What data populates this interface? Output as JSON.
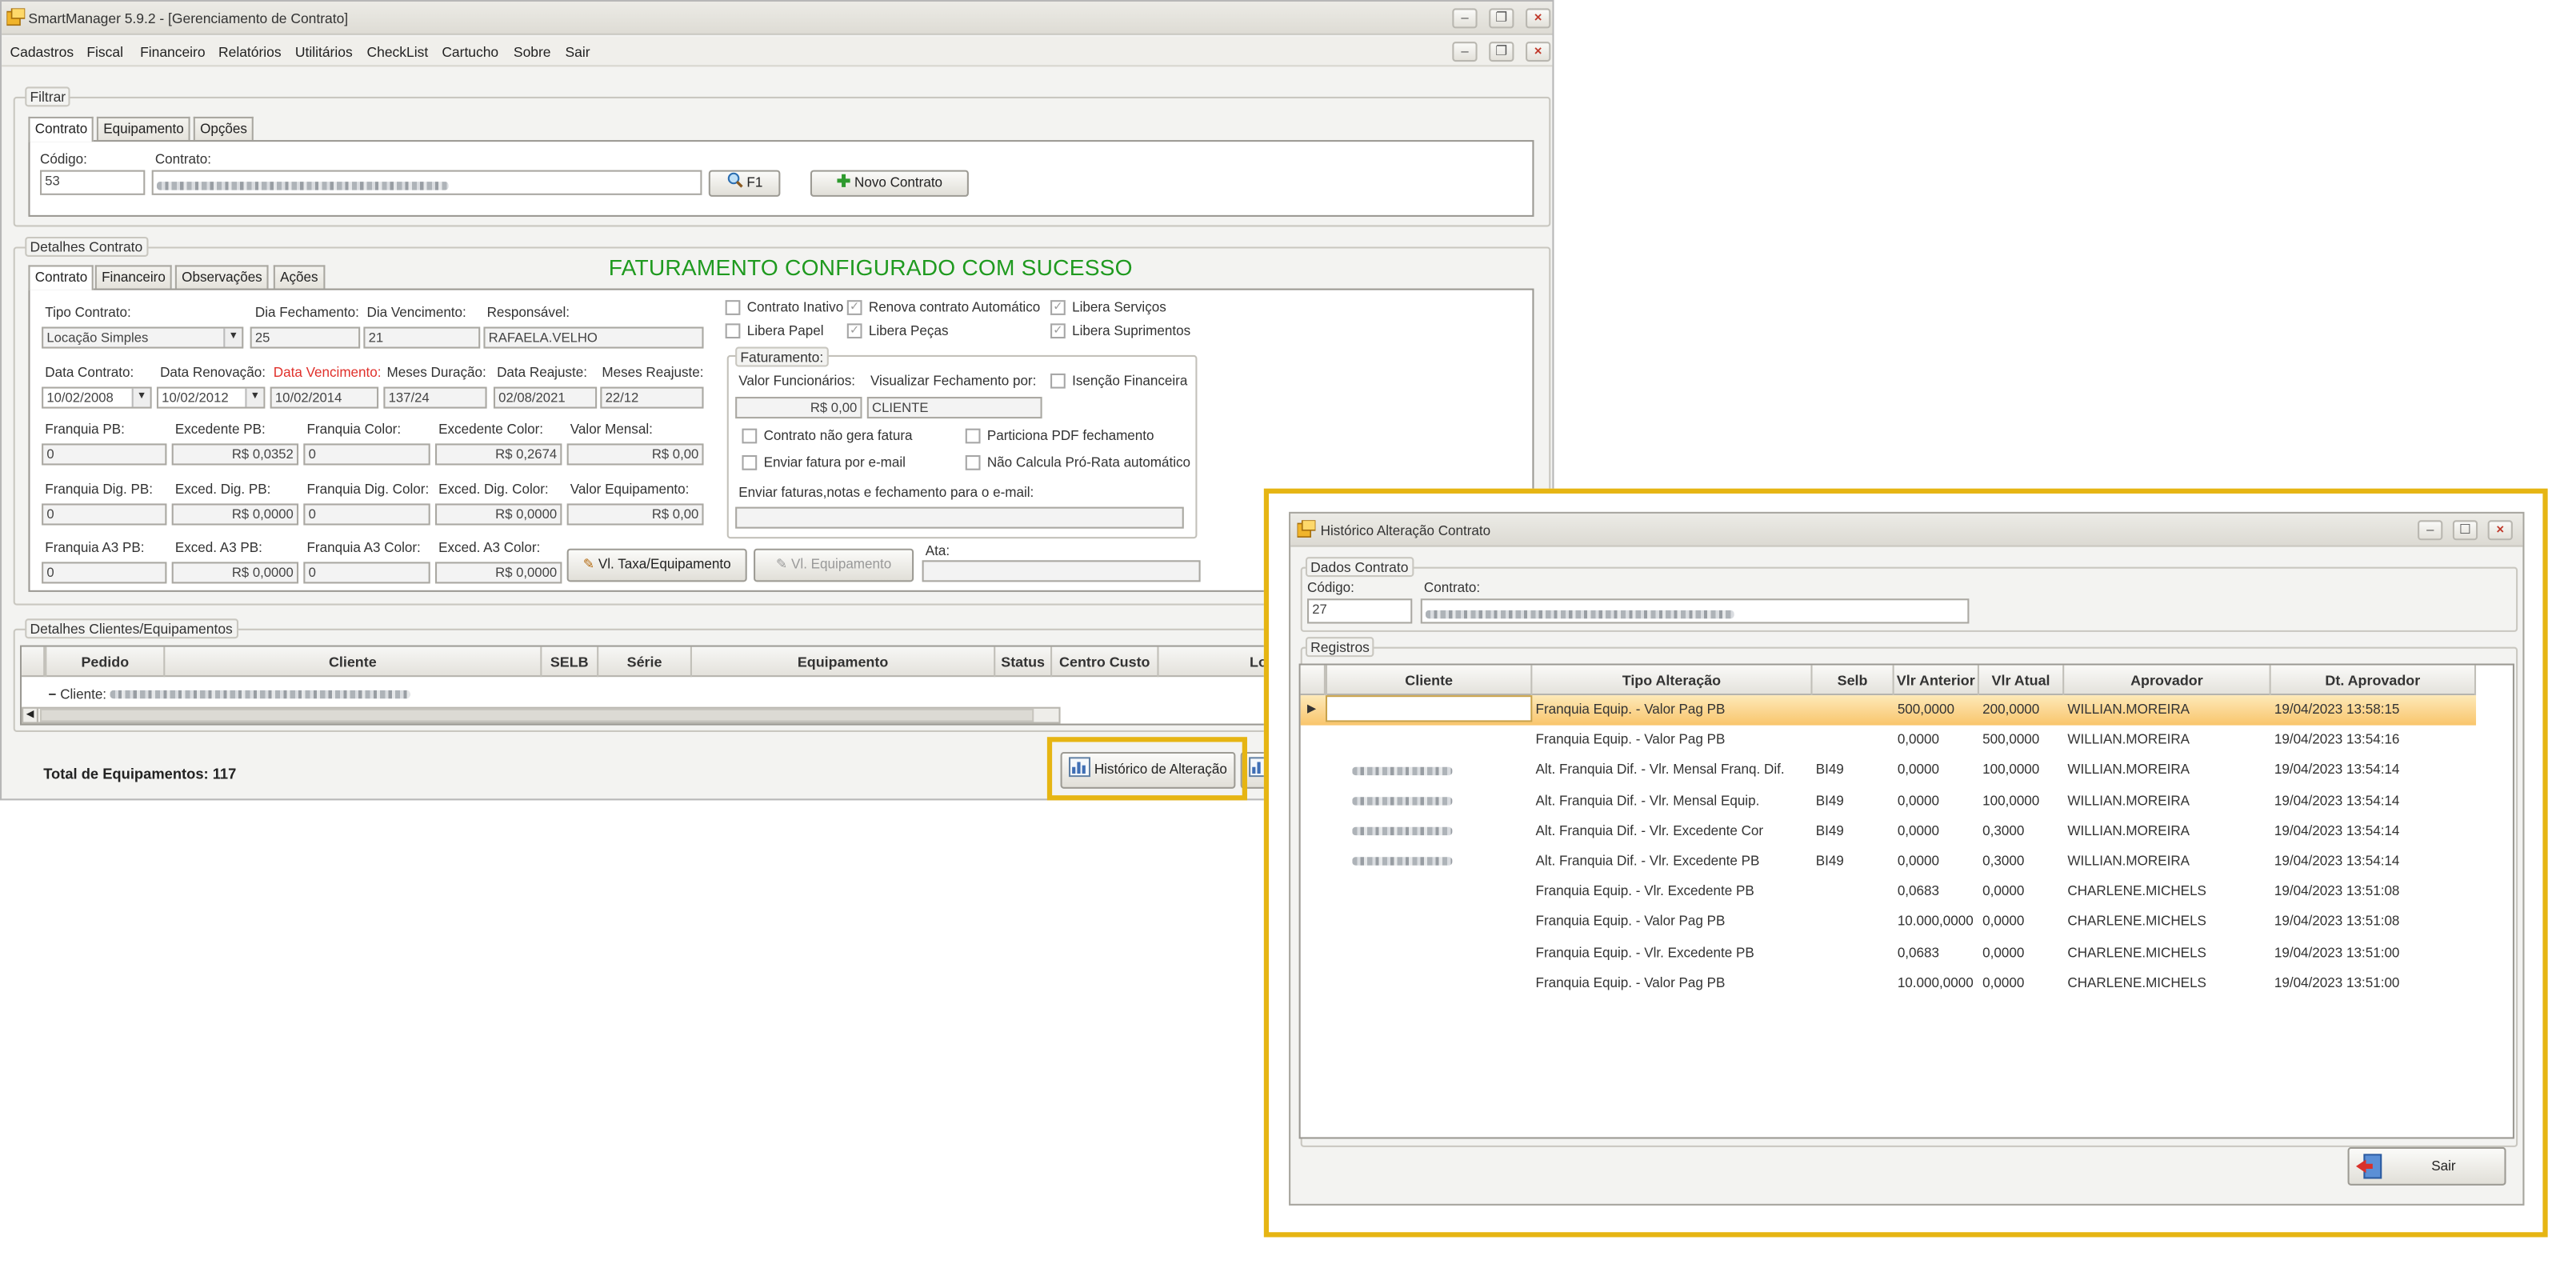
{
  "main": {
    "title": "SmartManager 5.9.2 - [Gerenciamento de Contrato]",
    "menu": [
      "Cadastros",
      "Fiscal",
      "Financeiro",
      "Relatórios",
      "Utilitários",
      "CheckList",
      "Cartucho",
      "Sobre",
      "Sair"
    ],
    "filter": {
      "legend": "Filtrar",
      "tabs": [
        "Contrato",
        "Equipamento",
        "Opções"
      ],
      "codigo_label": "Código:",
      "codigo_value": "53",
      "contrato_label": "Contrato:",
      "f1_label": "F1",
      "novo_label": "Novo Contrato"
    },
    "details": {
      "legend": "Detalhes Contrato",
      "tabs": [
        "Contrato",
        "Financeiro",
        "Observações",
        "Ações"
      ],
      "success_message": "FATURAMENTO CONFIGURADO COM SUCESSO",
      "tipo_contrato_label": "Tipo Contrato:",
      "tipo_contrato_value": "Locação Simples",
      "dia_fechamento_label": "Dia Fechamento:",
      "dia_fechamento_value": "25",
      "dia_vencimento_label": "Dia Vencimento:",
      "dia_vencimento_value": "21",
      "responsavel_label": "Responsável:",
      "responsavel_value": "RAFAELA.VELHO",
      "data_contrato_label": "Data Contrato:",
      "data_contrato_value": "10/02/2008",
      "data_renovacao_label": "Data Renovação:",
      "data_renovacao_value": "10/02/2012",
      "data_vencimento_label": "Data Vencimento:",
      "data_vencimento_value": "10/02/2014",
      "meses_duracao_label": "Meses Duração:",
      "meses_duracao_value": "137/24",
      "data_reajuste_label": "Data Reajuste:",
      "data_reajuste_value": "02/08/2021",
      "meses_reajuste_label": "Meses Reajuste:",
      "meses_reajuste_value": "22/12",
      "franquia_pb_label": "Franquia PB:",
      "franquia_pb_value": "0",
      "excedente_pb_label": "Excedente PB:",
      "excedente_pb_value": "R$ 0,0352",
      "franquia_color_label": "Franquia Color:",
      "franquia_color_value": "0",
      "excedente_color_label": "Excedente Color:",
      "excedente_color_value": "R$ 0,2674",
      "valor_mensal_label": "Valor Mensal:",
      "valor_mensal_value": "R$ 0,00",
      "franquia_dig_pb_label": "Franquia Dig. PB:",
      "franquia_dig_pb_value": "0",
      "exced_dig_pb_label": "Exced. Dig. PB:",
      "exced_dig_pb_value": "R$ 0,0000",
      "franquia_dig_color_label": "Franquia Dig. Color:",
      "franquia_dig_color_value": "0",
      "exced_dig_color_label": "Exced. Dig. Color:",
      "exced_dig_color_value": "R$ 0,0000",
      "valor_equipamento_label": "Valor Equipamento:",
      "valor_equipamento_value": "R$ 0,00",
      "franquia_a3_pb_label": "Franquia A3 PB:",
      "franquia_a3_pb_value": "0",
      "exced_a3_pb_label": "Exced. A3 PB:",
      "exced_a3_pb_value": "R$ 0,0000",
      "franquia_a3_color_label": "Franquia A3 Color:",
      "franquia_a3_color_value": "0",
      "exced_a3_color_label": "Exced. A3 Color:",
      "exced_a3_color_value": "R$ 0,0000",
      "vl_taxa_label": "Vl. Taxa/Equipamento",
      "vl_equip_label": "Vl. Equipamento",
      "ata_label": "Ata:",
      "checks": {
        "contrato_inativo": "Contrato Inativo",
        "renova_automatico": "Renova contrato Automático",
        "libera_servicos": "Libera Serviços",
        "libera_papel": "Libera Papel",
        "libera_pecas": "Libera Peças",
        "libera_suprimentos": "Libera Suprimentos"
      },
      "faturamento": {
        "legend": "Faturamento:",
        "valor_funcionarios_label": "Valor Funcionários:",
        "valor_funcionarios_value": "R$ 0,00",
        "visualizar_label": "Visualizar Fechamento por:",
        "visualizar_value": "CLIENTE",
        "isencao_label": "Isenção Financeira",
        "nao_gera_fatura": "Contrato não gera fatura",
        "particiona_pdf": "Particiona PDF fechamento",
        "enviar_email": "Enviar fatura por e-mail",
        "nao_calcula": "Não Calcula Pró-Rata automático",
        "enviar_faturas_label": "Enviar faturas,notas e fechamento para o e-mail:"
      }
    },
    "clients": {
      "legend": "Detalhes Clientes/Equipamentos",
      "columns": [
        "Pedido",
        "Cliente",
        "SELB",
        "Série",
        "Equipamento",
        "Status",
        "Centro Custo",
        "Loca"
      ],
      "client_prefix": "Cliente:",
      "total_label": "Total de Equipamentos: 117",
      "historico_button": "Histórico de Alteração",
      "r_button": "R"
    }
  },
  "dialog": {
    "title": "Histórico Alteração Contrato",
    "dados_legend": "Dados Contrato",
    "codigo_label": "Código:",
    "codigo_value": "27",
    "contrato_label": "Contrato:",
    "registros_legend": "Registros",
    "columns": [
      "Cliente",
      "Tipo Alteração",
      "Selb",
      "Vlr Anterior",
      "Vlr Atual",
      "Aprovador",
      "Dt. Aprovador"
    ],
    "rows": [
      {
        "cliente": "",
        "tipo": "Franquia Equip. -  Valor Pag PB",
        "selb": "",
        "anterior": "500,0000",
        "atual": "200,0000",
        "aprovador": "WILLIAN.MOREIRA",
        "data": "19/04/2023 13:58:15"
      },
      {
        "cliente": "",
        "tipo": "Franquia Equip. -  Valor Pag PB",
        "selb": "",
        "anterior": "0,0000",
        "atual": "500,0000",
        "aprovador": "WILLIAN.MOREIRA",
        "data": "19/04/2023 13:54:16"
      },
      {
        "cliente": "blur",
        "tipo": "Alt. Franquia Dif. - Vlr. Mensal Franq. Dif.",
        "selb": "BI49",
        "anterior": "0,0000",
        "atual": "100,0000",
        "aprovador": "WILLIAN.MOREIRA",
        "data": "19/04/2023 13:54:14"
      },
      {
        "cliente": "blur",
        "tipo": "Alt. Franquia Dif. - Vlr. Mensal Equip.",
        "selb": "BI49",
        "anterior": "0,0000",
        "atual": "100,0000",
        "aprovador": "WILLIAN.MOREIRA",
        "data": "19/04/2023 13:54:14"
      },
      {
        "cliente": "blur",
        "tipo": "Alt. Franquia Dif. - Vlr. Excedente Cor",
        "selb": "BI49",
        "anterior": "0,0000",
        "atual": "0,3000",
        "aprovador": "WILLIAN.MOREIRA",
        "data": "19/04/2023 13:54:14"
      },
      {
        "cliente": "blur",
        "tipo": "Alt. Franquia Dif. - Vlr. Excedente PB",
        "selb": "BI49",
        "anterior": "0,0000",
        "atual": "0,3000",
        "aprovador": "WILLIAN.MOREIRA",
        "data": "19/04/2023 13:54:14"
      },
      {
        "cliente": "",
        "tipo": "Franquia Equip. -  Vlr. Excedente PB",
        "selb": "",
        "anterior": "0,0683",
        "atual": "0,0000",
        "aprovador": "CHARLENE.MICHELS",
        "data": "19/04/2023 13:51:08"
      },
      {
        "cliente": "",
        "tipo": "Franquia Equip. -  Valor Pag PB",
        "selb": "",
        "anterior": "10.000,0000",
        "atual": "0,0000",
        "aprovador": "CHARLENE.MICHELS",
        "data": "19/04/2023 13:51:08"
      },
      {
        "cliente": "",
        "tipo": "Franquia Equip. -  Vlr. Excedente PB",
        "selb": "",
        "anterior": "0,0683",
        "atual": "0,0000",
        "aprovador": "CHARLENE.MICHELS",
        "data": "19/04/2023 13:51:00"
      },
      {
        "cliente": "",
        "tipo": "Franquia Equip. -  Valor Pag PB",
        "selb": "",
        "anterior": "10.000,0000",
        "atual": "0,0000",
        "aprovador": "CHARLENE.MICHELS",
        "data": "19/04/2023 13:51:00"
      }
    ],
    "sair_label": "Sair"
  },
  "colors": {
    "highlight": "#e6b513",
    "success": "#1f9a1f",
    "selected_row": "#f9c56c"
  }
}
